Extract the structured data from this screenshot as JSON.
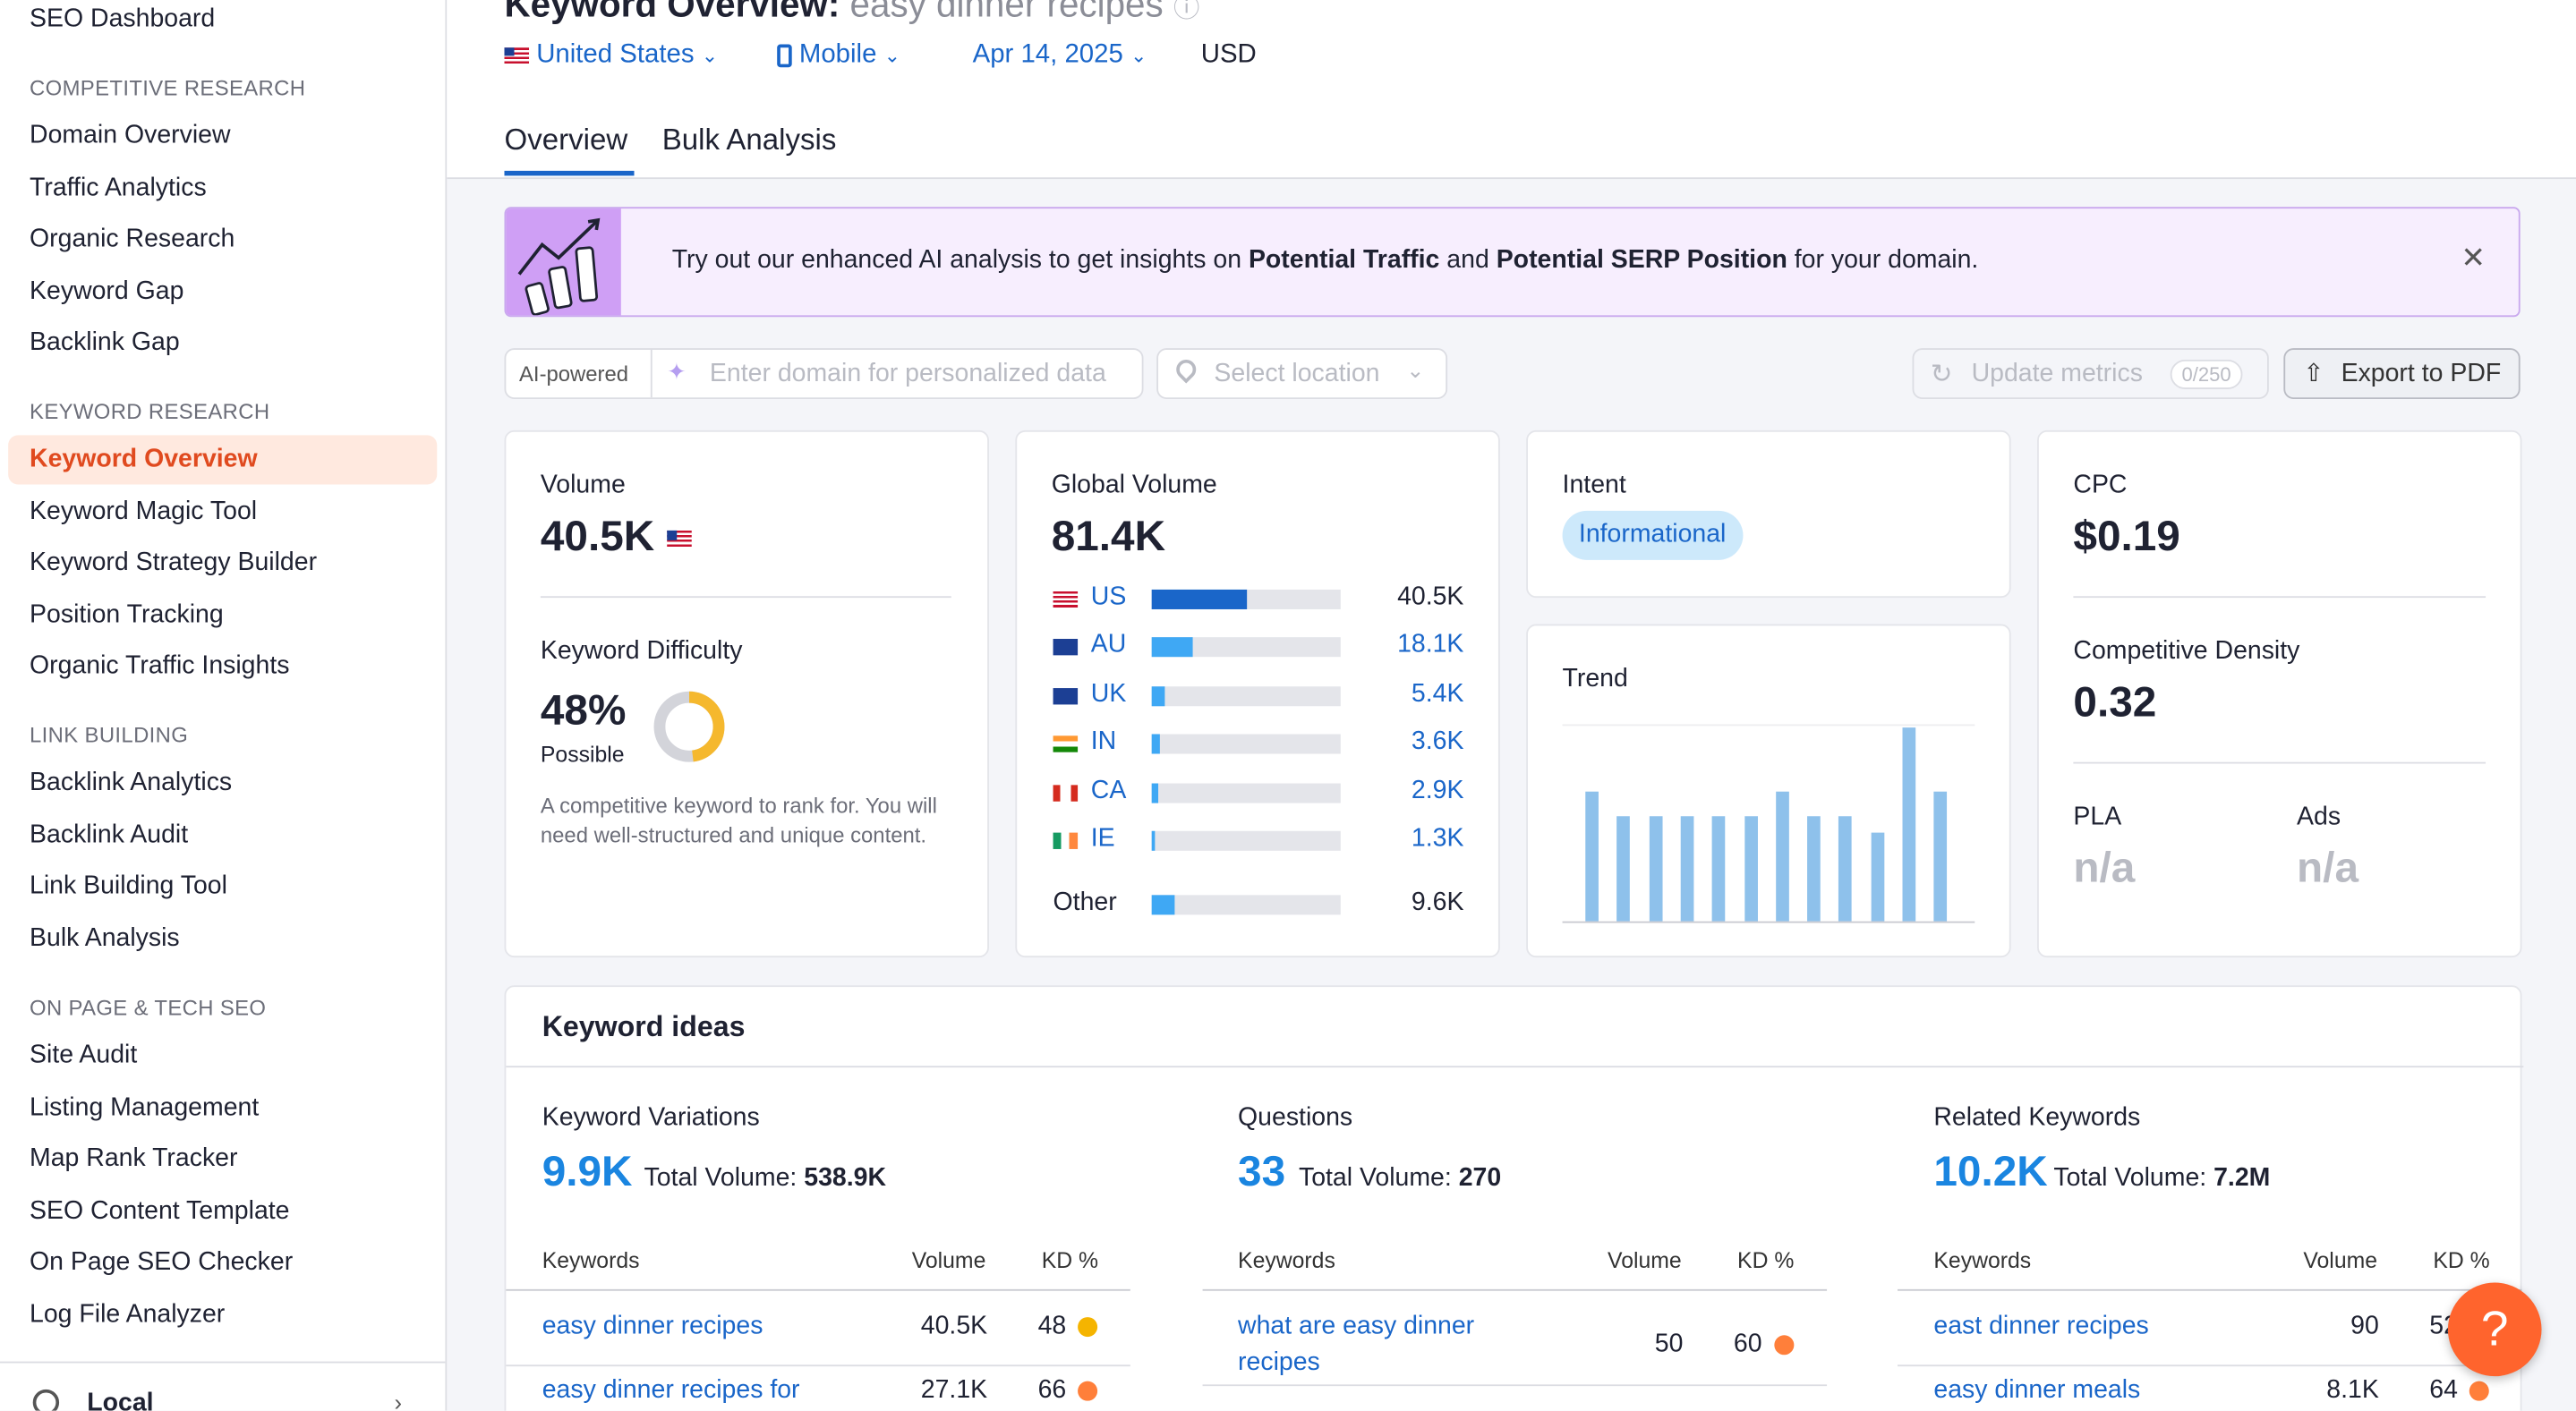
{
  "sidebar": {
    "top_item": "SEO Dashboard",
    "sections": [
      {
        "heading": "COMPETITIVE RESEARCH",
        "items": [
          "Domain Overview",
          "Traffic Analytics",
          "Organic Research",
          "Keyword Gap",
          "Backlink Gap"
        ]
      },
      {
        "heading": "KEYWORD RESEARCH",
        "items": [
          "Keyword Overview",
          "Keyword Magic Tool",
          "Keyword Strategy Builder",
          "Position Tracking",
          "Organic Traffic Insights"
        ]
      },
      {
        "heading": "LINK BUILDING",
        "items": [
          "Backlink Analytics",
          "Backlink Audit",
          "Link Building Tool",
          "Bulk Analysis"
        ]
      },
      {
        "heading": "ON PAGE & TECH SEO",
        "items": [
          "Site Audit",
          "Listing Management",
          "Map Rank Tracker",
          "SEO Content Template",
          "On Page SEO Checker",
          "Log File Analyzer"
        ]
      }
    ],
    "active_item": "Keyword Overview",
    "bottom_item": "Local"
  },
  "header": {
    "title": "Keyword Overview:",
    "keyword": "easy dinner recipes",
    "filters": {
      "country": "United States",
      "device": "Mobile",
      "date": "Apr 14, 2025",
      "currency": "USD"
    },
    "tabs": [
      "Overview",
      "Bulk Analysis"
    ]
  },
  "banner": {
    "text_before": "Try out our enhanced AI analysis to get insights on",
    "bold1": "Potential Traffic",
    "and": "and",
    "bold2": "Potential SERP Position",
    "text_after": "for your domain.",
    "close": "✕"
  },
  "toolbar": {
    "ai_label": "AI-powered",
    "domain_placeholder": "Enter domain for personalized data",
    "location_placeholder": "Select location",
    "update_label": "Update metrics",
    "update_badge": "0/250",
    "export_label": "Export to PDF"
  },
  "volume_card": {
    "label": "Volume",
    "value": "40.5K",
    "kd_label": "Keyword Difficulty",
    "kd_value": "48%",
    "kd_level": "Possible",
    "kd_percent": 48,
    "kd_description": "A competitive keyword to rank for. You will need well-structured and unique content."
  },
  "global_card": {
    "label": "Global Volume",
    "value": "81.4K",
    "rows": [
      {
        "code": "US",
        "value": "40.5K",
        "fraction": 0.5,
        "color": "#1a66c9"
      },
      {
        "code": "AU",
        "value": "18.1K",
        "fraction": 0.22,
        "color": "#3fa8f4"
      },
      {
        "code": "UK",
        "value": "5.4K",
        "fraction": 0.07,
        "color": "#3fa8f4"
      },
      {
        "code": "IN",
        "value": "3.6K",
        "fraction": 0.045,
        "color": "#3fa8f4"
      },
      {
        "code": "CA",
        "value": "2.9K",
        "fraction": 0.036,
        "color": "#3fa8f4"
      },
      {
        "code": "IE",
        "value": "1.3K",
        "fraction": 0.016,
        "color": "#3fa8f4"
      }
    ],
    "other_label": "Other",
    "other_value": "9.6K",
    "other_fraction": 0.12
  },
  "intent_card": {
    "label": "Intent",
    "badge": "Informational"
  },
  "trend_card": {
    "label": "Trend",
    "values": [
      0.67,
      0.54,
      0.54,
      0.54,
      0.54,
      0.54,
      0.67,
      0.54,
      0.54,
      0.46,
      1.0,
      0.67
    ]
  },
  "cpc_card": {
    "label": "CPC",
    "value": "$0.19",
    "cd_label": "Competitive Density",
    "cd_value": "0.32",
    "pla_label": "PLA",
    "pla_value": "n/a",
    "ads_label": "Ads",
    "ads_value": "n/a"
  },
  "keyword_ideas": {
    "title": "Keyword ideas",
    "headers": {
      "keywords": "Keywords",
      "volume": "Volume",
      "kd": "KD %"
    },
    "columns": [
      {
        "title": "Keyword Variations",
        "count": "9.9K",
        "tv_label": "Total Volume:",
        "tv_value": "538.9K",
        "rows": [
          {
            "kw": "easy dinner recipes",
            "vol": "40.5K",
            "kd": "48",
            "dot": "#f5b400"
          },
          {
            "kw": "easy dinner recipes for",
            "vol": "27.1K",
            "kd": "66",
            "dot": "#ff7f3a"
          }
        ]
      },
      {
        "title": "Questions",
        "count": "33",
        "tv_label": "Total Volume:",
        "tv_value": "270",
        "rows": [
          {
            "kw": "what are easy dinner recipes",
            "vol": "50",
            "kd": "60",
            "dot": "#ff7f3a"
          }
        ]
      },
      {
        "title": "Related Keywords",
        "count": "10.2K",
        "tv_label": "Total Volume:",
        "tv_value": "7.2M",
        "rows": [
          {
            "kw": "east dinner recipes",
            "vol": "90",
            "kd": "52",
            "dot": "#f5b400"
          },
          {
            "kw": "easy dinner meals",
            "vol": "8.1K",
            "kd": "64",
            "dot": "#ff7f3a"
          }
        ]
      }
    ]
  },
  "help_label": "?",
  "colors": {
    "accent": "#1a66c9",
    "orange": "#ff642d",
    "active_bg": "#ffe9df"
  }
}
